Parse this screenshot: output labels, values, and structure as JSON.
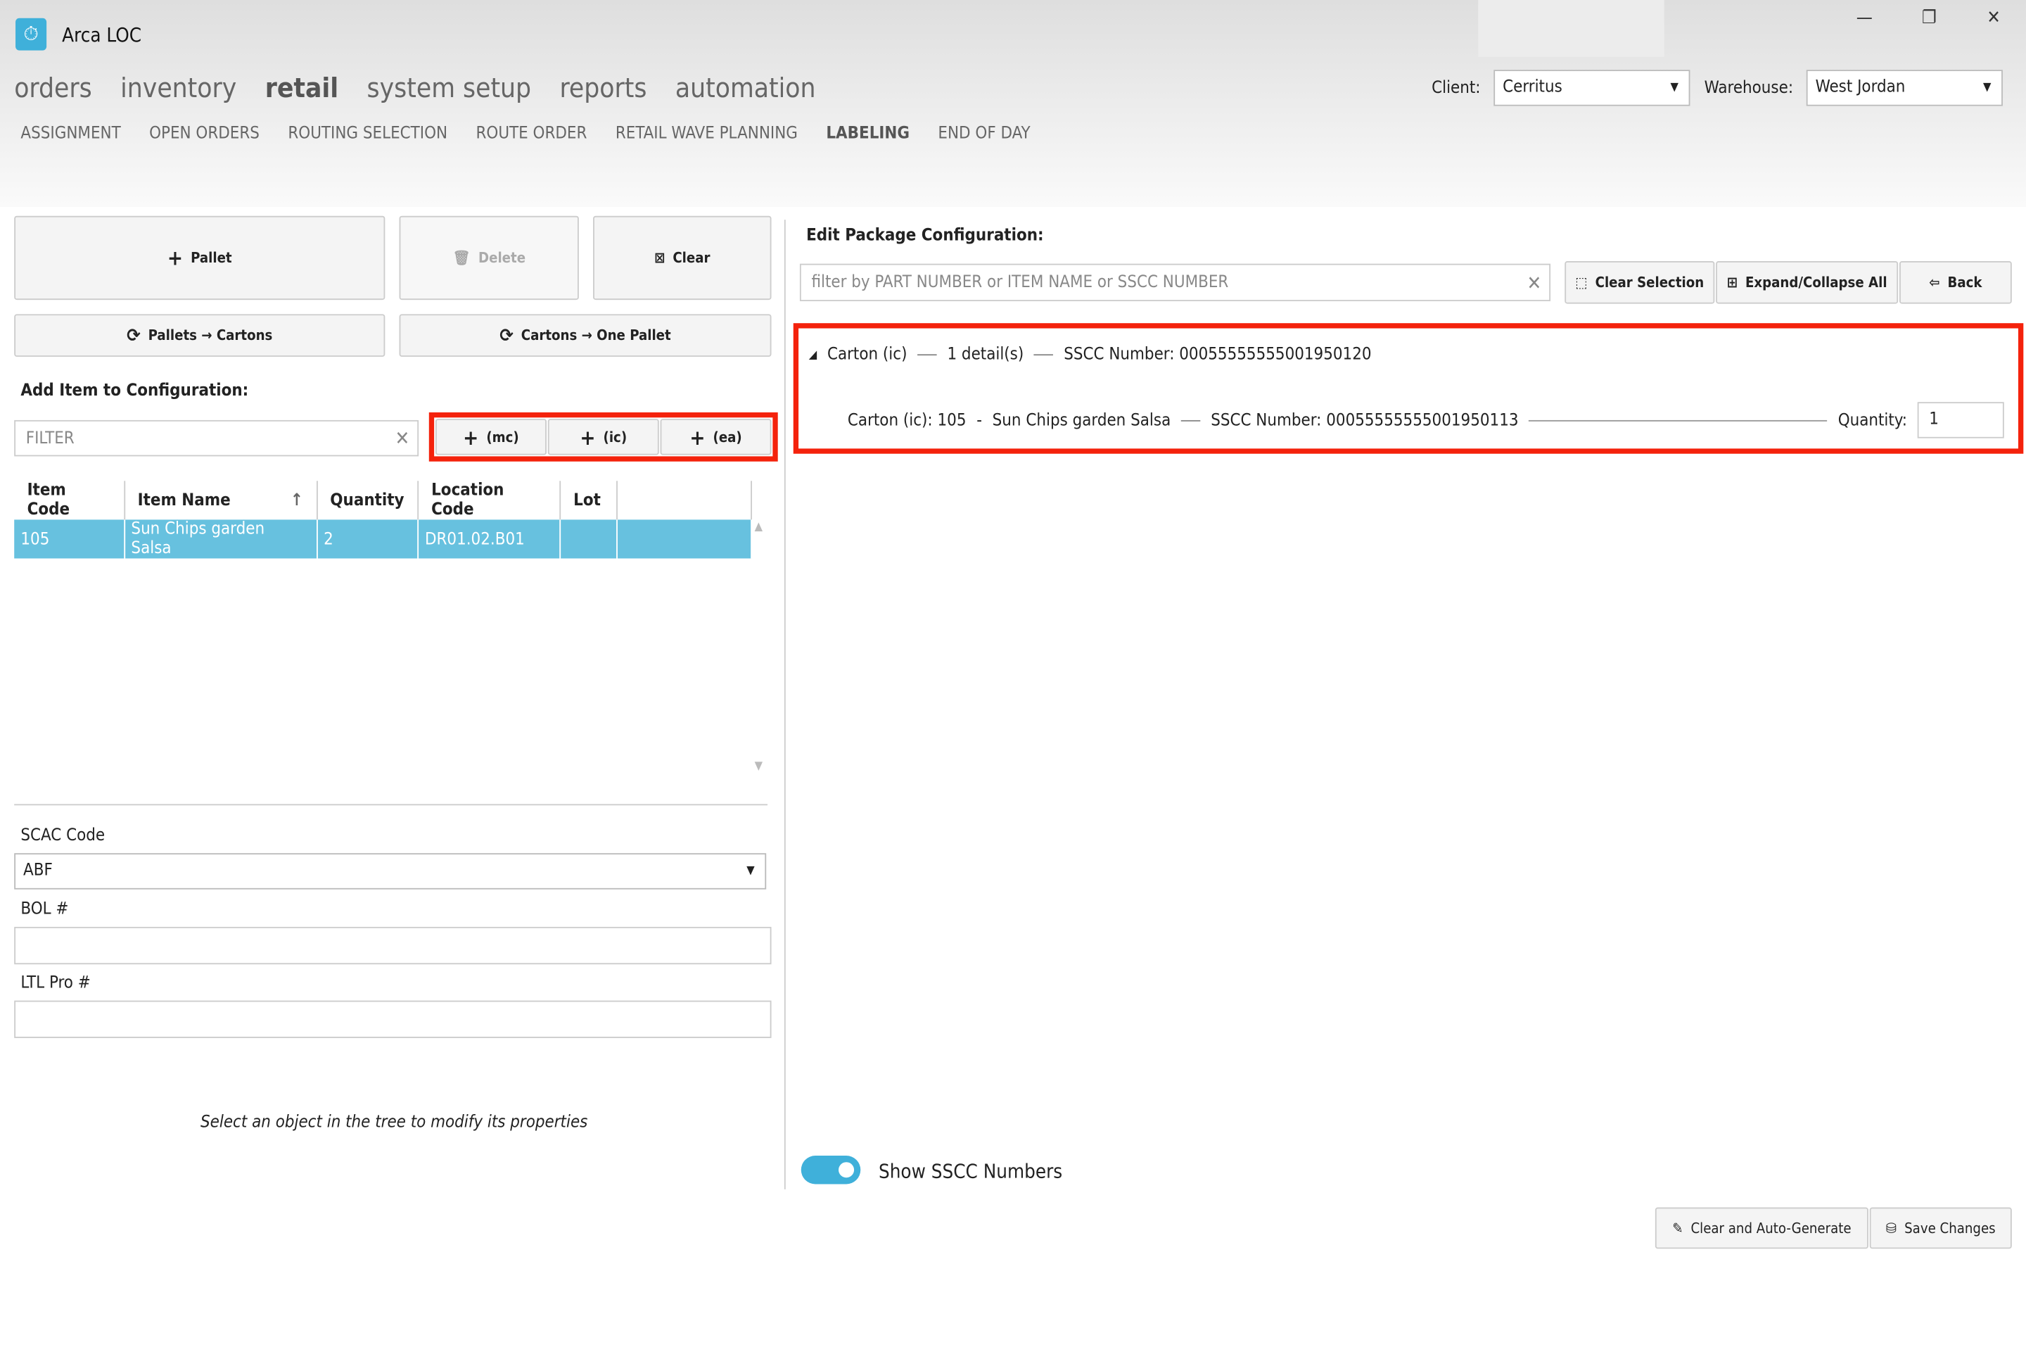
{
  "app": {
    "title": "Arca LOC"
  },
  "window": {
    "minimize": "—",
    "restore": "❐",
    "close": "✕"
  },
  "main_nav": [
    {
      "label": "orders"
    },
    {
      "label": "inventory"
    },
    {
      "label": "retail",
      "active": true
    },
    {
      "label": "system setup"
    },
    {
      "label": "reports"
    },
    {
      "label": "automation"
    }
  ],
  "sub_nav": [
    {
      "label": "ASSIGNMENT"
    },
    {
      "label": "OPEN ORDERS"
    },
    {
      "label": "ROUTING SELECTION"
    },
    {
      "label": "ROUTE ORDER"
    },
    {
      "label": "RETAIL WAVE PLANNING"
    },
    {
      "label": "LABELING",
      "active": true
    },
    {
      "label": "END OF DAY"
    }
  ],
  "client": {
    "label": "Client:",
    "value": "Cerritus"
  },
  "warehouse": {
    "label": "Warehouse:",
    "value": "West Jordan"
  },
  "left": {
    "pallet": "Pallet",
    "delete": "Delete",
    "clear": "Clear",
    "pallets_to_cartons": "Pallets → Cartons",
    "cartons_to_pallet": "Cartons → One Pallet",
    "add_item_label": "Add Item to Configuration:",
    "filter_placeholder": "FILTER",
    "add_mc": "(mc)",
    "add_ic": "(ic)",
    "add_ea": "(ea)",
    "columns": [
      "Item Code",
      "Item Name",
      "Quantity",
      "Location Code",
      "Lot"
    ],
    "rows": [
      {
        "item_code": "105",
        "item_name": "Sun Chips garden Salsa",
        "quantity": "2",
        "location_code": "DR01.02.B01",
        "lot": ""
      }
    ],
    "scac_label": "SCAC Code",
    "scac_value": "ABF",
    "bol_label": "BOL #",
    "bol_value": "",
    "ltl_label": "LTL Pro #",
    "ltl_value": "",
    "hint": "Select an object in the tree to modify its properties"
  },
  "right": {
    "title": "Edit Package Configuration:",
    "filter_placeholder": "filter by PART NUMBER or ITEM NAME or SSCC NUMBER",
    "clear_selection": "Clear Selection",
    "expand_collapse": "Expand/Collapse All",
    "back": "Back",
    "tree": {
      "node": "Carton (ic)",
      "details": "1 detail(s)",
      "sscc": "SSCC Number: 00055555555001950120",
      "child": {
        "label": "Carton (ic): 105",
        "sep": "-",
        "name": "Sun Chips garden Salsa",
        "sscc": "SSCC Number: 00055555555001950113",
        "qty_label": "Quantity:",
        "qty": "1"
      }
    },
    "show_sscc": "Show SSCC Numbers",
    "show_sscc_on": true,
    "auto_generate": "Clear and Auto-Generate",
    "save": "Save Changes"
  },
  "colors": {
    "accent": "#3fb0da",
    "highlight": "#f4220c",
    "selected_row": "#67c1df"
  }
}
